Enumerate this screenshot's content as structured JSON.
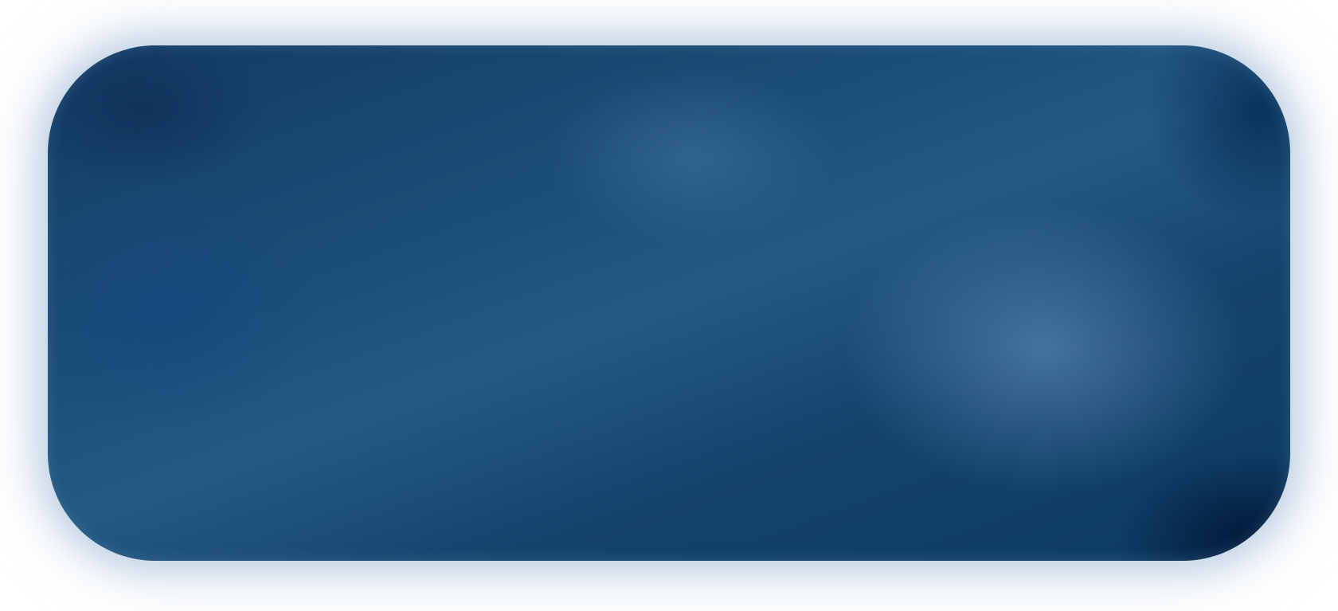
{
  "panel": {
    "colors": {
      "dark_navy": "#0c3a62",
      "mid_blue": "#245a85",
      "highlight": "#4a77a2",
      "glow": "#a9c1d8"
    }
  }
}
